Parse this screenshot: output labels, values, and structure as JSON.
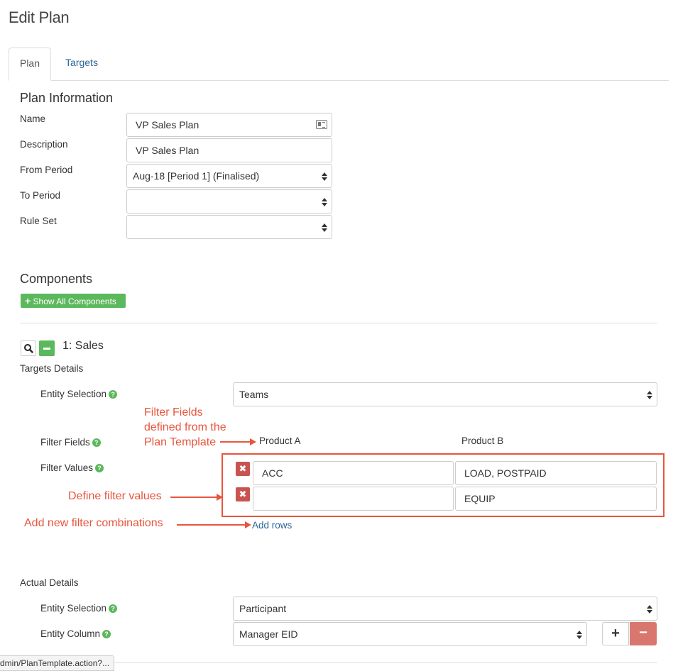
{
  "page": {
    "title": "Edit Plan"
  },
  "tabs": [
    {
      "label": "Plan"
    },
    {
      "label": "Targets"
    }
  ],
  "plan_info": {
    "heading": "Plan Information",
    "name": {
      "label": "Name",
      "value": "VP Sales Plan"
    },
    "description": {
      "label": "Description",
      "value": "VP Sales Plan"
    },
    "from_period": {
      "label": "From Period",
      "value": "Aug-18 [Period 1] (Finalised)"
    },
    "to_period": {
      "label": "To Period",
      "value": ""
    },
    "rule_set": {
      "label": "Rule Set",
      "value": ""
    }
  },
  "components": {
    "heading": "Components",
    "show_all_label": "Show All Components",
    "component": {
      "title": "1: Sales"
    }
  },
  "targets_details": {
    "heading": "Targets Details",
    "entity_selection": {
      "label": "Entity Selection",
      "value": "Teams"
    },
    "filter_fields": {
      "label": "Filter Fields",
      "columns": [
        "Product A",
        "Product B"
      ]
    },
    "filter_values": {
      "label": "Filter Values",
      "rows": [
        [
          "ACC",
          "LOAD, POSTPAID"
        ],
        [
          "",
          "EQUIP"
        ]
      ]
    },
    "add_rows_label": "Add rows"
  },
  "annotations": {
    "filter_fields": [
      "Filter Fields",
      "defined from the",
      "Plan Template"
    ],
    "filter_values": "Define filter values",
    "add_rows": "Add new filter combinations"
  },
  "actual_details": {
    "heading": "Actual Details",
    "entity_selection": {
      "label": "Entity Selection",
      "value": "Participant"
    },
    "entity_column": {
      "label": "Entity Column",
      "value": "Manager EID"
    }
  },
  "status_bar": {
    "url": "dmin/PlanTemplate.action?..."
  },
  "colors": {
    "accent_green": "#5cb85c",
    "delete_red": "#c9534f",
    "annotation": "#e8553d",
    "link": "#2a6496"
  }
}
